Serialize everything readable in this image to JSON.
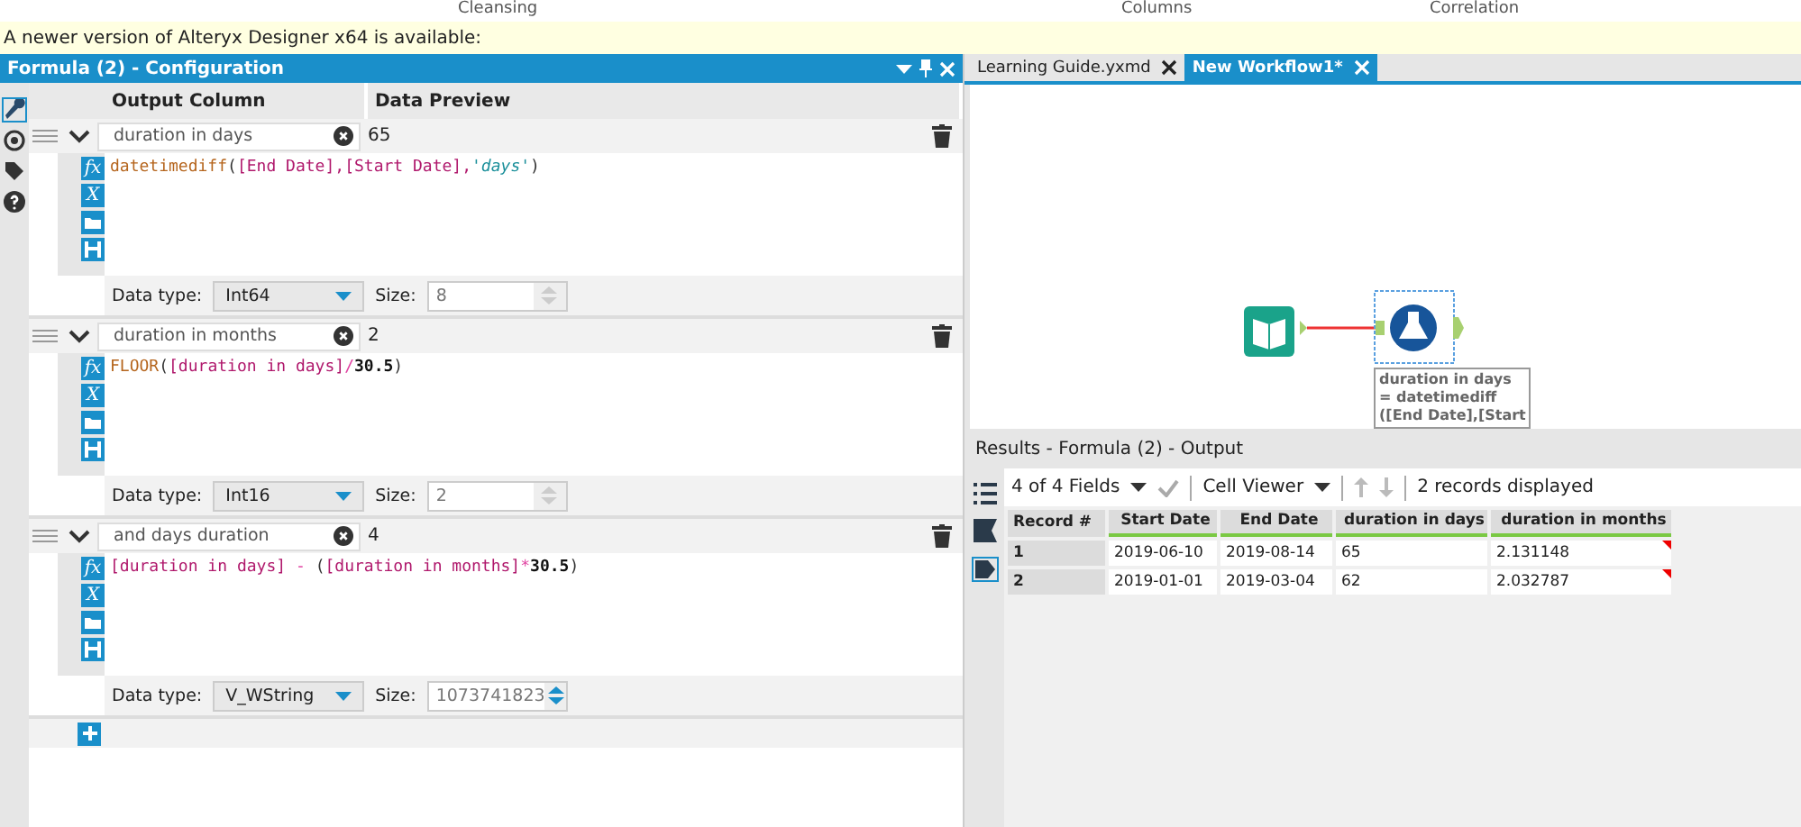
{
  "ribbon": [
    "Cleansing",
    "Columns",
    "Correlation"
  ],
  "banner": "A newer version of Alteryx Designer x64 is available:",
  "config": {
    "title": "Formula (2) - Configuration",
    "columns": [
      "Output Column",
      "Data Preview"
    ],
    "formulas": [
      {
        "name": "duration in days",
        "preview": "65",
        "icons": [
          "fx",
          "X"
        ],
        "tokens": [
          {
            "kind": "function",
            "text": "datetimediff"
          },
          {
            "kind": "paren",
            "text": "("
          },
          {
            "kind": "field",
            "text": "[End Date],"
          },
          {
            "kind": "field",
            "text": "[Start Date],"
          },
          {
            "kind": "string",
            "text": "'days'"
          },
          {
            "kind": "paren",
            "text": ")"
          }
        ],
        "type_label": "Data type:",
        "type": "Int64",
        "size_label": "Size:",
        "size": "8",
        "size_enabled": false
      },
      {
        "name": "duration in months",
        "preview": "2",
        "icons": [
          "fx",
          "X"
        ],
        "tokens": [
          {
            "kind": "function",
            "text": "FLOOR"
          },
          {
            "kind": "paren",
            "text": "("
          },
          {
            "kind": "field",
            "text": "[duration in days]"
          },
          {
            "kind": "operator",
            "text": "/"
          },
          {
            "kind": "number",
            "text": "30.5"
          },
          {
            "kind": "paren",
            "text": ")"
          }
        ],
        "type_label": "Data type:",
        "type": "Int16",
        "size_label": "Size:",
        "size": "2",
        "size_enabled": false
      },
      {
        "name": "and days duration",
        "preview": "4",
        "icons": [
          "fx",
          "X"
        ],
        "tokens": [
          {
            "kind": "field",
            "text": "[duration in days]"
          },
          {
            "kind": "operator",
            "text": " - "
          },
          {
            "kind": "paren",
            "text": "("
          },
          {
            "kind": "field",
            "text": "[duration in months]"
          },
          {
            "kind": "operator",
            "text": "*"
          },
          {
            "kind": "number",
            "text": "30.5"
          },
          {
            "kind": "paren",
            "text": ")"
          }
        ],
        "type_label": "Data type:",
        "type": "V_WString",
        "size_label": "Size:",
        "size": "1073741823",
        "size_enabled": true
      }
    ]
  },
  "tabs": [
    {
      "label": "Learning Guide.yxmd",
      "selected": false
    },
    {
      "label": "New Workflow1*",
      "selected": true
    }
  ],
  "canvas": {
    "annotation": [
      "duration in days",
      "= datetimediff",
      "([End Date],[Start"
    ]
  },
  "results": {
    "title": "Results - Formula (2) - Output",
    "fields": "4 of 4 Fields",
    "viewer": "Cell Viewer",
    "status": "2 records displayed",
    "columns": [
      "Record #",
      "Start Date",
      "End Date",
      "duration in days",
      "duration in months"
    ],
    "rows": [
      [
        "1",
        "2019-06-10",
        "2019-08-14",
        "65",
        "2.131148"
      ],
      [
        "2",
        "2019-01-01",
        "2019-03-04",
        "62",
        "2.032787"
      ]
    ]
  }
}
